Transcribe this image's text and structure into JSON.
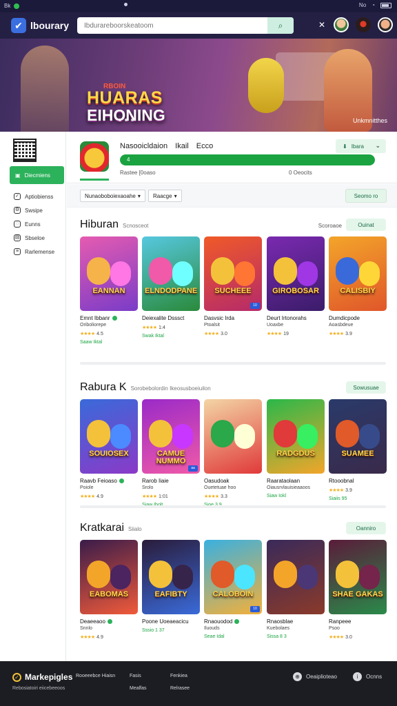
{
  "status_bar": {
    "left_text": "Bk",
    "right_text": "No"
  },
  "app_bar": {
    "logo_text": "lbourary",
    "search_placeholder": "Ibdurareboorskeatoom",
    "tool_icons": [
      "tools-icon",
      "moon-icon"
    ]
  },
  "hero": {
    "tag": "RBOIN",
    "headline_line1": "HUARAS",
    "headline_line2": "EIHONING",
    "caption": "Unkmnitthes"
  },
  "sidebar": {
    "active_label": "Diecmiens",
    "items": [
      {
        "label": "Aptiobienss",
        "icon": "check-circle-icon"
      },
      {
        "label": "Swsipe",
        "icon": "gear-icon"
      },
      {
        "label": "Eunns",
        "icon": "chat-icon"
      },
      {
        "label": "Sbseloe",
        "icon": "doc-icon"
      },
      {
        "label": "Rarlemense",
        "icon": "list-icon"
      }
    ]
  },
  "profile": {
    "title_words": [
      "Nasooicldaion",
      "Ikail",
      "Ecco"
    ],
    "install_label": "Ibara",
    "progress_percent": 100,
    "progress_label": "4",
    "meta_left": "Rastee  [0oaso",
    "meta_right": "0  Oeocits"
  },
  "filters": {
    "chip1": "Nunaoboboiexaoahe",
    "chip2": "Raacge",
    "filter_button": "Seomo  ro"
  },
  "sections": [
    {
      "title": "Hiburan",
      "subtitle": "Scnosceot",
      "right_text": "Scoroaoe",
      "button": "Ouinat",
      "cards": [
        {
          "name": "Emnt Ibbanr",
          "dev": "Oriboliorepe",
          "rating": "4.5",
          "price": "Saaw Iktal",
          "colors": [
            "#e55bb0",
            "#7a3cc8",
            "#f6b34a"
          ],
          "title": "EANNAN",
          "badge": ""
        },
        {
          "name": "Deiexalite Dsssct",
          "dev": "",
          "rating": "1:4",
          "price": "Swak Iktal",
          "colors": [
            "#56c8e0",
            "#2a8a3a",
            "#f05aa8"
          ],
          "title": "ELNDODPANE",
          "badge": ""
        },
        {
          "name": "Dasvsic Irda",
          "dev": "Ptoalsit",
          "rating": "3.0",
          "price": "",
          "colors": [
            "#f05a28",
            "#b52a6a",
            "#f3c23a"
          ],
          "title": "SUCHEEE",
          "badge": "10"
        },
        {
          "name": "Deurt Irtonorahs",
          "dev": "Uoaxbe",
          "rating": "19",
          "price": "",
          "colors": [
            "#7a2ab0",
            "#3b1c6a",
            "#f3c23a"
          ],
          "title": "GIROBOSAR",
          "badge": ""
        },
        {
          "name": "Dumdicpode",
          "dev": "Aoasbdeue",
          "rating": "3.9",
          "price": "",
          "colors": [
            "#f3a52a",
            "#e0562a",
            "#3a6ad9"
          ],
          "title": "CALISBIY",
          "badge": ""
        }
      ]
    },
    {
      "title": "Rabura K",
      "subtitle": "Sorobebolordin  Ikeosusboeiuilon",
      "right_text": "",
      "button": "Sowusuae",
      "cards": [
        {
          "name": "Raavb Feioaso",
          "dev": "Poiole",
          "rating": "4.9",
          "price": "",
          "colors": [
            "#3a6ad9",
            "#8a3ac8",
            "#f3c23a"
          ],
          "title": "SOUIOSEX",
          "badge": ""
        },
        {
          "name": "Rarob Iiaie",
          "dev": "Srolo",
          "rating": "1:01",
          "price": "Siaw Ibolt",
          "colors": [
            "#9a2ac8",
            "#f05aa8",
            "#f3c23a"
          ],
          "title": "CAMUE NUMMO",
          "badge": "aa"
        },
        {
          "name": "Oasudoak",
          "dev": "Ouetetuae hoo",
          "rating": "3.3",
          "price": "Sioe 3.9",
          "colors": [
            "#f3d5a5",
            "#e03a3a",
            "#2aa84a"
          ],
          "title": "",
          "badge": ""
        },
        {
          "name": "Raarataolaan",
          "dev": "Oiausrvlauisieaaoos",
          "rating": "",
          "price": "Siaw Iokl",
          "colors": [
            "#2ab84a",
            "#f3a52a",
            "#e03a3a"
          ],
          "title": "RADGDUS",
          "badge": ""
        },
        {
          "name": "Rtooobnal",
          "dev": "",
          "rating": "3.9",
          "price": "Siaiis  95",
          "colors": [
            "#2a3a6a",
            "#3a2a4a",
            "#e05a2a"
          ],
          "title": "SUAMEE",
          "badge": ""
        }
      ]
    },
    {
      "title": "Kratkarai",
      "subtitle": "Siialo",
      "right_text": "",
      "button": "Oanniro",
      "cards": [
        {
          "name": "Deaeeaoo",
          "dev": "Snnlo",
          "rating": "4.9",
          "price": "",
          "colors": [
            "#3a1c4a",
            "#f05a3a",
            "#f3a52a"
          ],
          "title": "EABOMAS",
          "badge": ""
        },
        {
          "name": "Poone Uoeaeacicu",
          "dev": "",
          "rating": "",
          "price": "Sssio  1 37",
          "colors": [
            "#2a1c3a",
            "#3a6ad9",
            "#f3c23a"
          ],
          "title": "EAFIBTY",
          "badge": ""
        },
        {
          "name": "Rnaouodod",
          "dev": "Iluouds",
          "rating": "",
          "price": "Seae Idal",
          "colors": [
            "#3ab0e0",
            "#f3b03a",
            "#e05a2a"
          ],
          "title": "CALOBOIN",
          "badge": "10"
        },
        {
          "name": "Rnaosblae",
          "dev": "Kuebolaes",
          "rating": "",
          "price": "Sissa 8 3",
          "colors": [
            "#3a2a5a",
            "#8a3a2a",
            "#f3a52a"
          ],
          "title": "",
          "badge": ""
        },
        {
          "name": "Ranpeee",
          "dev": "Psoo",
          "rating": "3.0",
          "price": "",
          "colors": [
            "#5a1c3a",
            "#2a8a4a",
            "#f3c23a"
          ],
          "title": "SHAE GAKAS",
          "badge": ""
        }
      ]
    }
  ],
  "footer": {
    "brand": "Markepigles",
    "tagline": "Rebosiatoiri  eiicebeeoos",
    "col1": [
      "Rooeeebce Hiaisn",
      ""
    ],
    "col2": [
      "Fasis",
      "Mealfas"
    ],
    "col3": [
      "Fenkiea",
      "Relrasee"
    ],
    "right1": "Oeaiplioteao",
    "right2": "Ocnns"
  }
}
